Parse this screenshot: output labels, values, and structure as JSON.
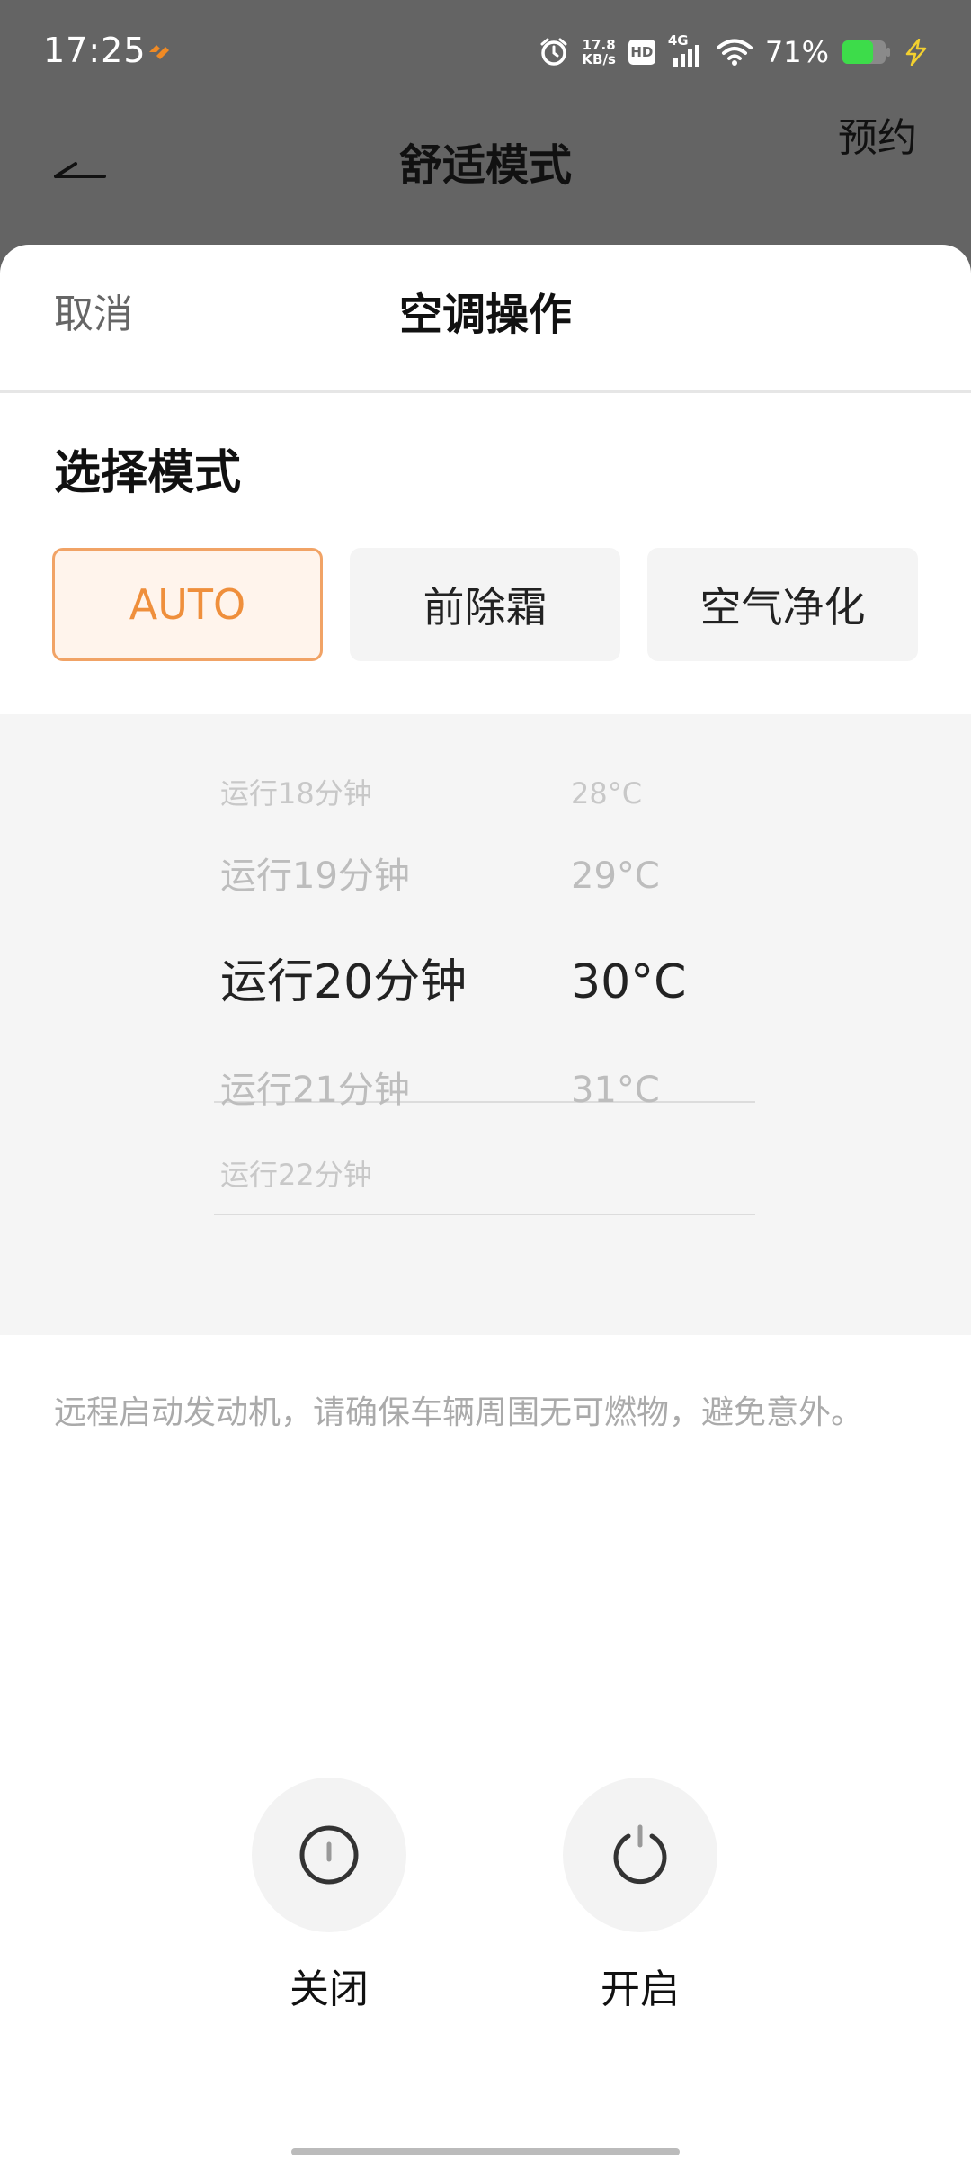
{
  "status_bar": {
    "time": "17:25",
    "net_speed_value": "17.8",
    "net_speed_unit": "KB/s",
    "hd_label": "HD",
    "network_label": "4G",
    "battery_percent": "71%",
    "battery_level": 0.71,
    "battery_color": "#3ddc4a"
  },
  "nav": {
    "title": "舒适模式",
    "reserve_label": "预约"
  },
  "sheet": {
    "cancel_label": "取消",
    "title": "空调操作",
    "section_title": "选择模式",
    "modes": [
      {
        "label": "AUTO",
        "selected": true
      },
      {
        "label": "前除霜",
        "selected": false
      },
      {
        "label": "空气净化",
        "selected": false
      }
    ],
    "picker": {
      "runtime_options": [
        "运行18分钟",
        "运行19分钟",
        "运行20分钟",
        "运行21分钟",
        "运行22分钟"
      ],
      "temp_options": [
        "28°C",
        "29°C",
        "30°C",
        "31°C"
      ],
      "selected_runtime": "运行20分钟",
      "selected_temp": "30°C"
    },
    "notice": "远程启动发动机，请确保车辆周围无可燃物，避免意外。",
    "controls": {
      "off_label": "关闭",
      "on_label": "开启"
    },
    "accent_color": "#ef8f3c"
  }
}
